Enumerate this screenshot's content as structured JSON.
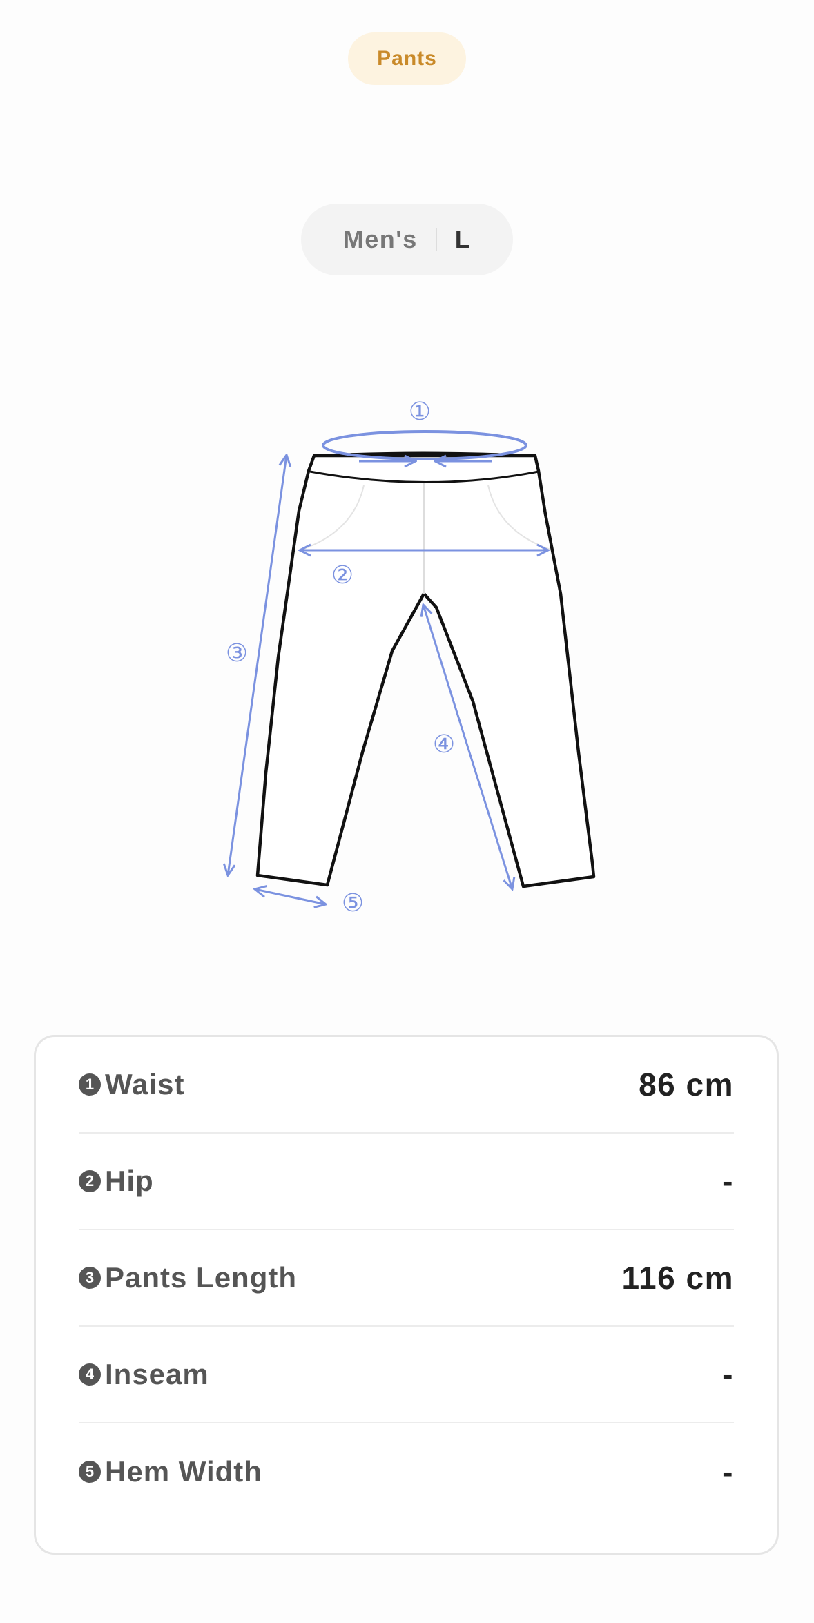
{
  "category_chip": "Pants",
  "size": {
    "gender": "Men's",
    "value": "L"
  },
  "diagram": {
    "labels": [
      "①",
      "②",
      "③",
      "④",
      "⑤"
    ],
    "accent_color": "#7b92e0"
  },
  "measurements": [
    {
      "num": "1",
      "label": "Waist",
      "value": "86 cm"
    },
    {
      "num": "2",
      "label": "Hip",
      "value": "-"
    },
    {
      "num": "3",
      "label": "Pants Length",
      "value": "116 cm"
    },
    {
      "num": "4",
      "label": "Inseam",
      "value": "-"
    },
    {
      "num": "5",
      "label": "Hem Width",
      "value": "-"
    }
  ]
}
